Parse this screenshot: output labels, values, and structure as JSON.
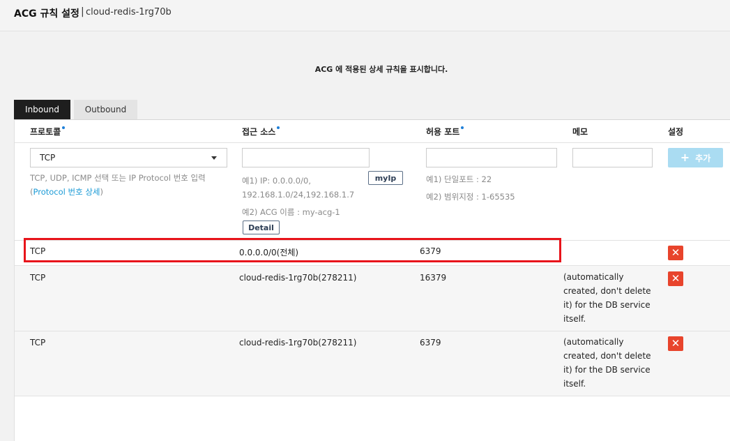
{
  "header": {
    "title": "ACG 규칙 설정",
    "separator": "|",
    "subtitle": "cloud-redis-1rg70b"
  },
  "description": "ACG 에 적용된 상세 규칙을 표시합니다.",
  "tabs": [
    {
      "label": "Inbound",
      "active": true
    },
    {
      "label": "Outbound",
      "active": false
    }
  ],
  "columns": {
    "protocol": "프로토콜",
    "source": "접근 소스",
    "port": "허용 포트",
    "memo": "메모",
    "settings": "설정"
  },
  "form": {
    "protocol_value": "TCP",
    "protocol_hint_1": "TCP, UDP, ICMP 선택 또는 IP Protocol 번호 입력",
    "protocol_hint_open": "(",
    "protocol_hint_link": "Protocol 번호 상세",
    "protocol_hint_close": ")",
    "source_hint_1": "예1) IP: 0.0.0.0/0,",
    "source_hint_2": "192.168.1.0/24,192.168.1.7",
    "source_hint_3": "예2) ACG 이름 : my-acg-1",
    "myip_label": "myIp",
    "detail_label": "Detail",
    "port_hint_1": "예1) 단일포트 : 22",
    "port_hint_2": "예2) 범위지정 : 1-65535",
    "add_label": "추가"
  },
  "rules": [
    {
      "protocol": "TCP",
      "source": "0.0.0.0/0(전체)",
      "port": "6379",
      "memo": ""
    },
    {
      "protocol": "TCP",
      "source": "cloud-redis-1rg70b(278211)",
      "port": "16379",
      "memo": "(automatically created, don't delete it) for the DB service itself."
    },
    {
      "protocol": "TCP",
      "source": "cloud-redis-1rg70b(278211)",
      "port": "6379",
      "memo": "(automatically created, don't delete it) for the DB service itself."
    }
  ],
  "delete_icon": "✕",
  "colors": {
    "accent": "#1a9ad6",
    "delete": "#e8442c",
    "highlight": "#e8141b",
    "add_button": "#aadcf2"
  }
}
